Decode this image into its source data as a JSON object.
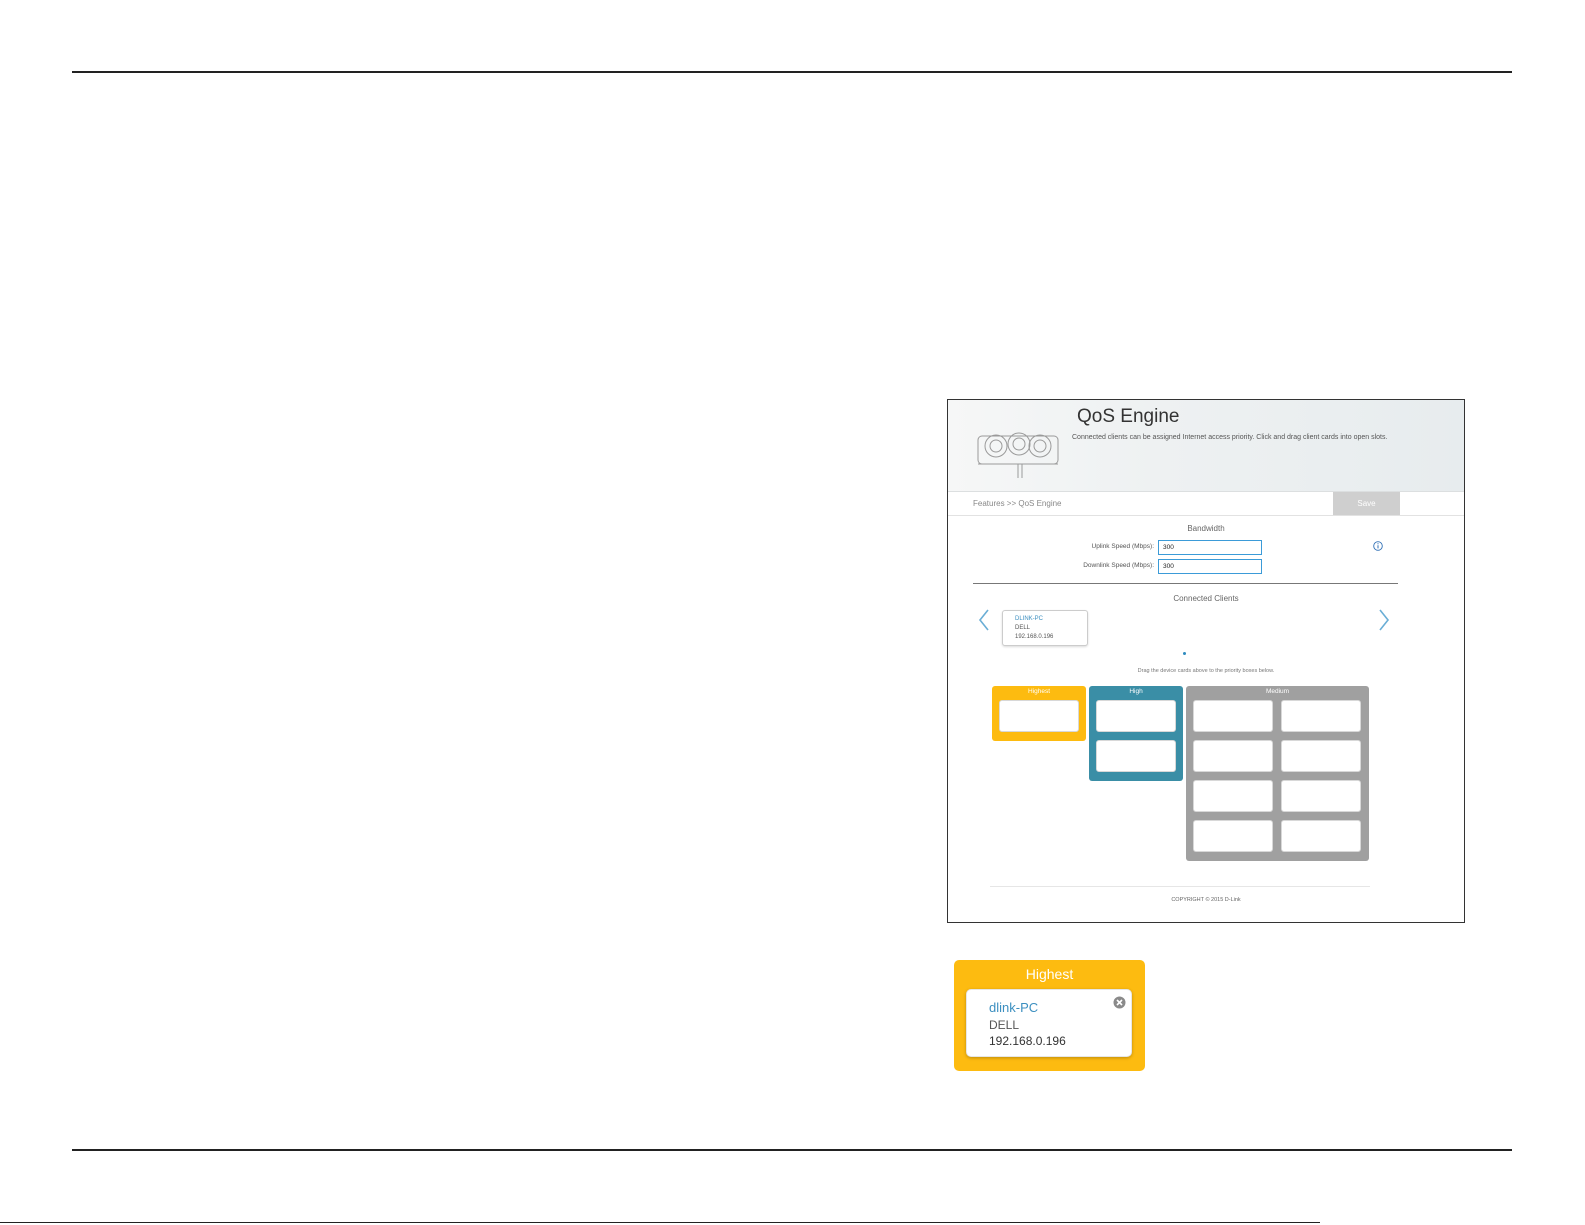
{
  "header": {
    "title": "QoS Engine",
    "description": "Connected clients can be assigned Internet access priority. Click and drag client cards into open slots."
  },
  "breadcrumb": "Features >> QoS Engine",
  "toolbar": {
    "save_label": "Save"
  },
  "bandwidth": {
    "title": "Bandwidth",
    "uplink_label": "Uplink Speed (Mbps):",
    "uplink_value": "300",
    "downlink_label": "Downlink Speed (Mbps):",
    "downlink_value": "300"
  },
  "connected_clients": {
    "title": "Connected Clients",
    "clients": [
      {
        "name": "DLINK-PC",
        "vendor": "DELL",
        "ip": "192.168.0.196"
      }
    ],
    "drag_hint": "Drag the device cards above to the priority boxes below."
  },
  "priorities": {
    "highest": {
      "label": "Highest",
      "slots": 1
    },
    "high": {
      "label": "High",
      "slots": 2
    },
    "medium": {
      "label": "Medium",
      "slots": 8
    }
  },
  "footer": {
    "copyright": "COPYRIGHT © 2015 D-Link"
  },
  "callout": {
    "label": "Highest",
    "client": {
      "name": "dlink-PC",
      "vendor": "DELL",
      "ip": "192.168.0.196"
    }
  },
  "colors": {
    "highest": "#fdbb10",
    "high": "#3a8ea6",
    "medium": "#a0a0a0",
    "accent": "#3b9bd8"
  }
}
